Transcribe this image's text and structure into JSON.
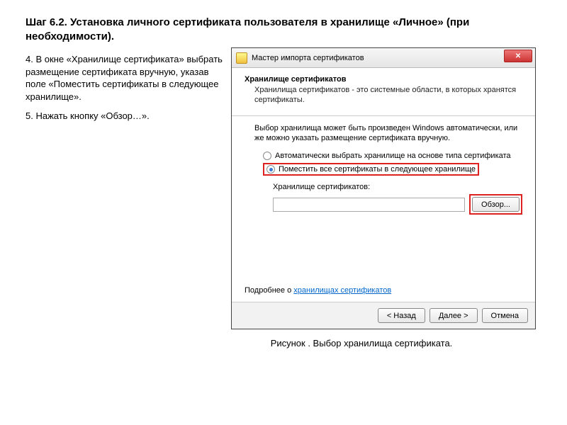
{
  "title": "Шаг 6.2. Установка личного сертификата пользователя в хранилище «Личное» (при необходимости).",
  "instructions": {
    "p1": "4. В окне «Хранилище сертификата» выбрать размещение сертификата вручную, указав поле «Поместить сертификаты в следующее хранилище».",
    "p2": "5. Нажать кнопку «Обзор…»."
  },
  "dialog": {
    "title": "Мастер импорта сертификатов",
    "section_title": "Хранилище сертификатов",
    "section_desc": "Хранилища сертификатов - это системные области, в которых хранятся сертификаты.",
    "info": "Выбор хранилища может быть произведен Windows автоматически, или же можно указать размещение сертификата вручную.",
    "radio1": "Автоматически выбрать хранилище на основе типа сертификата",
    "radio2": "Поместить все сертификаты в следующее хранилище",
    "store_label": "Хранилище сертификатов:",
    "browse": "Обзор...",
    "learn_prefix": "Подробнее о ",
    "learn_link": "хранилищах сертификатов",
    "back": "< Назад",
    "next": "Далее >",
    "cancel": "Отмена"
  },
  "caption": "Рисунок . Выбор хранилища сертификата."
}
